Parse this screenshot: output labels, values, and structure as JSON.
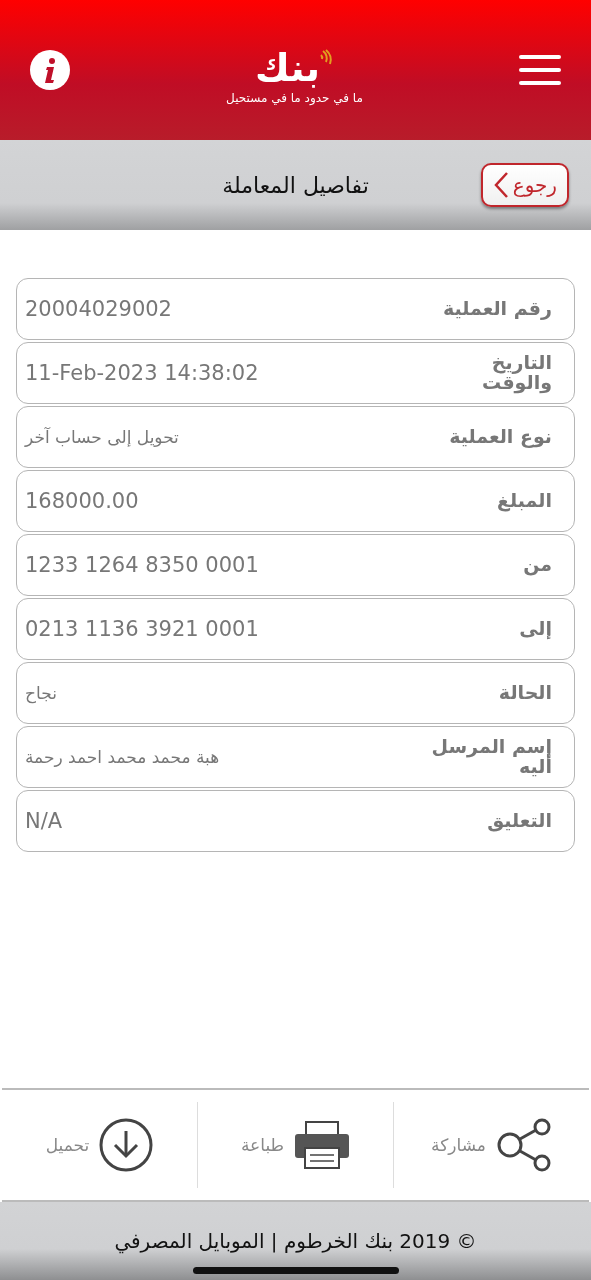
{
  "header": {
    "logo": "بنك",
    "tagline": "ما في حدود ما في مستحيل"
  },
  "title_bar": {
    "title": "تفاصيل المعاملة",
    "back_button": "رجوع"
  },
  "details": [
    {
      "label": "رقم العملية",
      "value": "20004029002"
    },
    {
      "label": "التاريخ والوقت",
      "value": "11-Feb-2023 14:38:02"
    },
    {
      "label": "نوع العملية",
      "value": "تحويل إلى حساب آخر"
    },
    {
      "label": "المبلغ",
      "value": "168000.00"
    },
    {
      "label": "من",
      "value": "1233 1264 8350 0001"
    },
    {
      "label": "إلى",
      "value": "0213 1136 3921 0001"
    },
    {
      "label": "الحالة",
      "value": "نجاح"
    },
    {
      "label": "إسم المرسل أليه",
      "value": "هبة محمد محمد احمد رحمة"
    },
    {
      "label": "التعليق",
      "value": "N/A"
    }
  ],
  "actions": [
    {
      "kind": "share",
      "label": "مشاركة"
    },
    {
      "kind": "print",
      "label": "طباعة"
    },
    {
      "kind": "download",
      "label": "تحميل"
    }
  ],
  "footer": "© 2019 بنك الخرطوم | الموبايل المصرفي"
}
